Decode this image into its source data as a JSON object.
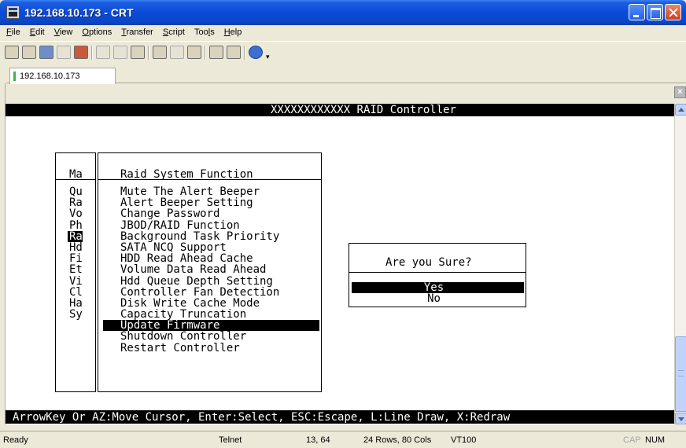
{
  "window": {
    "title": "192.168.10.173 - CRT"
  },
  "menu": [
    "File",
    "Edit",
    "View",
    "Options",
    "Transfer",
    "Script",
    "Tools",
    "Help"
  ],
  "menu_accel": [
    "F",
    "E",
    "V",
    "O",
    "T",
    "S",
    "l",
    "H"
  ],
  "session_tab": {
    "label": "192.168.10.173"
  },
  "terminal": {
    "header": "XXXXXXXXXXXX RAID Controller",
    "footer": "ArrowKey Or AZ:Move Cursor, Enter:Select, ESC:Escape, L:Line Draw, X:Redraw",
    "main_menu": {
      "title": "Ma",
      "items": [
        "Qu",
        "Ra",
        "Vo",
        "Ph",
        "Ra",
        "Hd",
        "Fi",
        "Et",
        "Vi",
        "Cl",
        "Ha",
        "Sy"
      ],
      "highlighted_index": 4
    },
    "raid_menu": {
      "title": "Raid System Function",
      "items": [
        "Mute The Alert Beeper",
        "Alert Beeper Setting",
        "Change Password",
        "JBOD/RAID Function",
        "Background Task Priority",
        "SATA NCQ Support",
        "HDD Read Ahead Cache",
        "Volume Data Read Ahead",
        "Hdd Queue Depth Setting",
        "Controller Fan Detection",
        "Disk Write Cache Mode",
        "Capacity Truncation",
        "Update Firmware",
        "Shutdown Controller",
        "Restart Controller"
      ],
      "highlighted_index": 12
    },
    "confirm": {
      "title": "Are you Sure?",
      "yes": "Yes",
      "no": "No"
    }
  },
  "status": {
    "state": "Ready",
    "protocol": "Telnet",
    "cursor": "13, 64",
    "size": "24 Rows, 80 Cols",
    "emulation": "VT100",
    "caps": "CAP",
    "num": "NUM"
  },
  "colors": {
    "title_bar": "#0a4bd8",
    "terminal_bg": "#ffffff",
    "terminal_fg": "#000000",
    "highlight_bg": "#000000"
  }
}
